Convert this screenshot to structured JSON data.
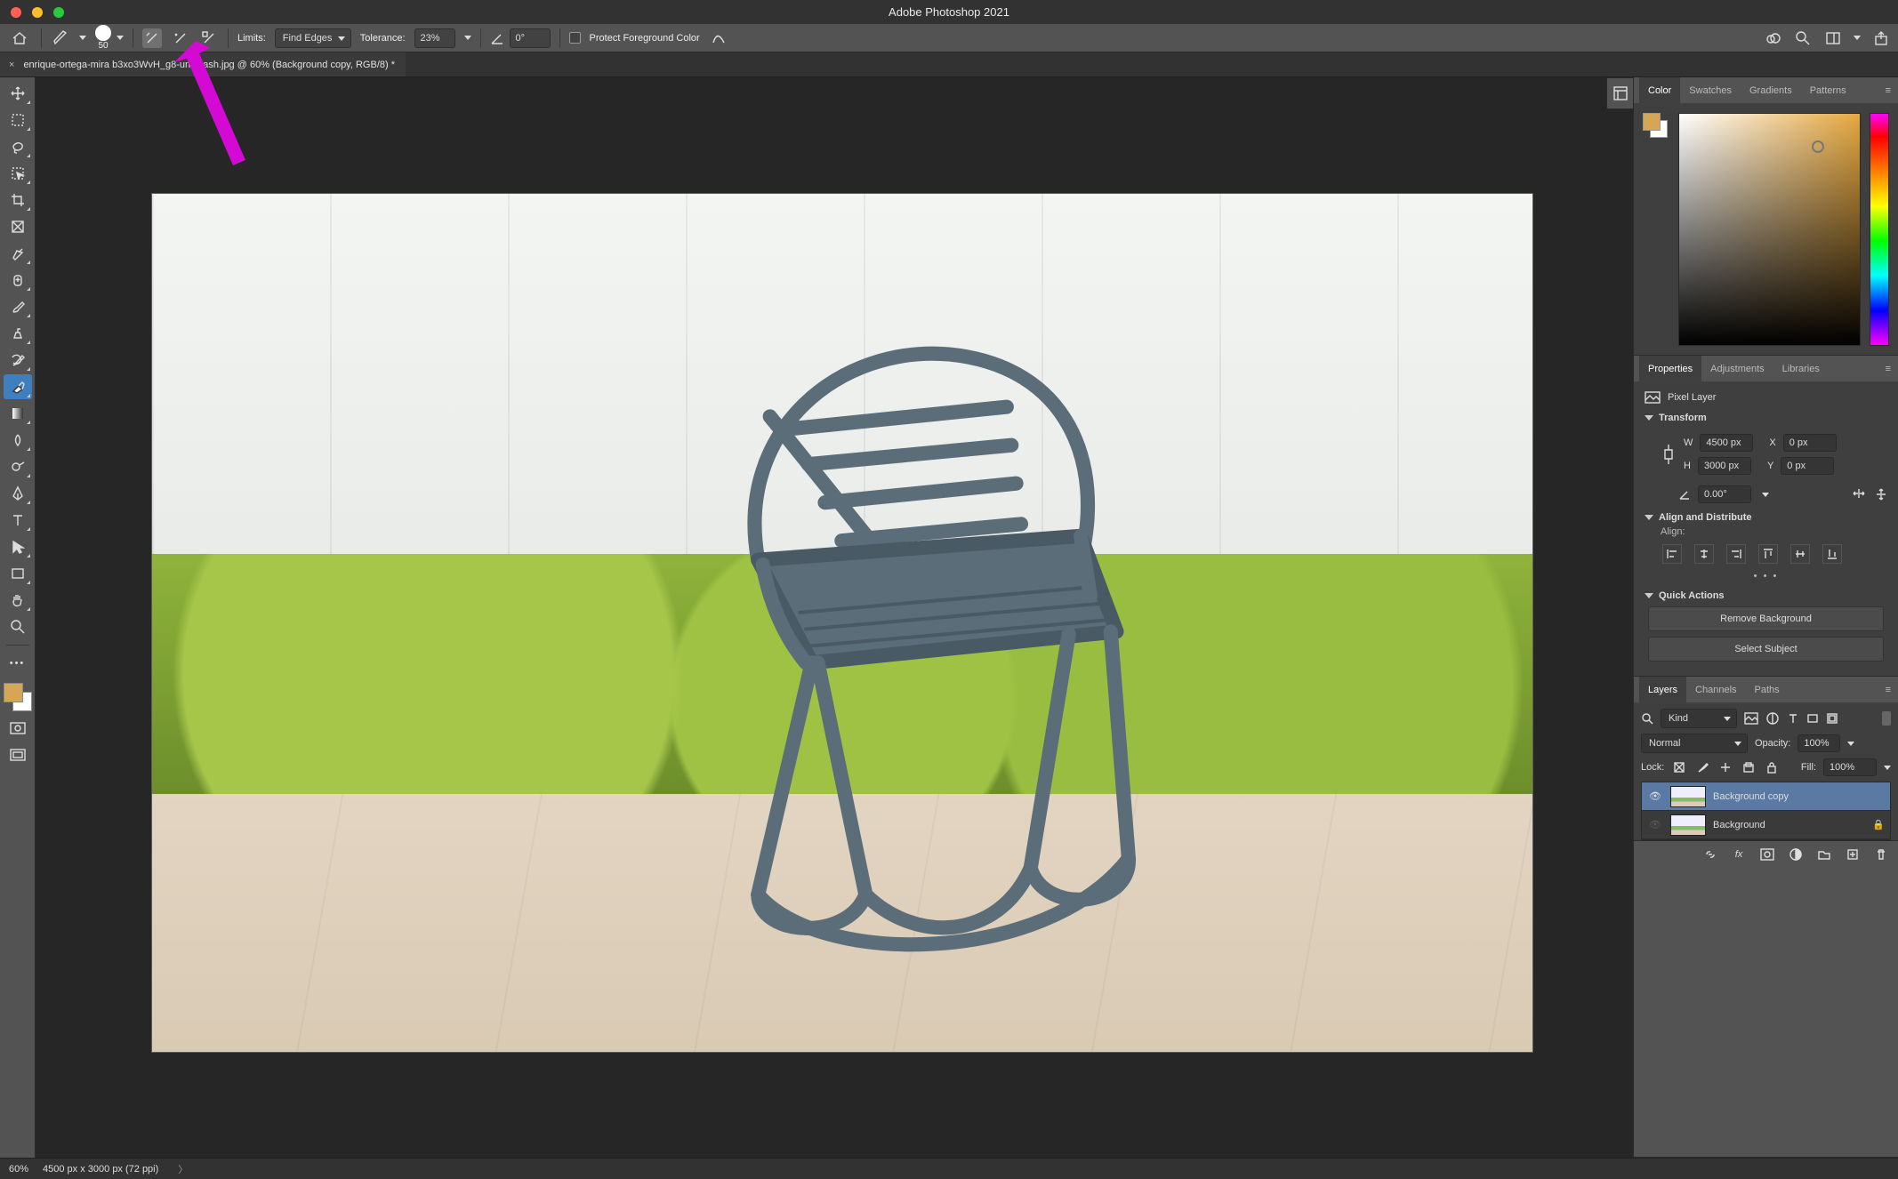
{
  "window": {
    "title": "Adobe Photoshop 2021"
  },
  "options": {
    "brush_size": "50",
    "limits_label": "Limits:",
    "limits_value": "Find Edges",
    "tolerance_label": "Tolerance:",
    "tolerance_value": "23%",
    "angle_value": "0°",
    "protect_label": "Protect Foreground Color"
  },
  "doc": {
    "tab_name": "enrique-ortega-mira        b3xo3WvH_g8-unsplash.jpg @ 60% (Background copy, RGB/8) *"
  },
  "panels": {
    "color": {
      "tabs": [
        "Color",
        "Swatches",
        "Gradients",
        "Patterns"
      ]
    },
    "properties": {
      "tabs": [
        "Properties",
        "Adjustments",
        "Libraries"
      ],
      "layer_type": "Pixel Layer",
      "transform_label": "Transform",
      "W_label": "W",
      "W_value": "4500 px",
      "H_label": "H",
      "H_value": "3000 px",
      "X_label": "X",
      "X_value": "0 px",
      "Y_label": "Y",
      "Y_value": "0 px",
      "angle_value": "0.00°",
      "align_label": "Align and Distribute",
      "align_sub": "Align:",
      "qa_label": "Quick Actions",
      "qa_remove": "Remove Background",
      "qa_select": "Select Subject"
    },
    "layers": {
      "tabs": [
        "Layers",
        "Channels",
        "Paths"
      ],
      "kind": "Kind",
      "blend": "Normal",
      "opacity_label": "Opacity:",
      "opacity_value": "100%",
      "lock_label": "Lock:",
      "fill_label": "Fill:",
      "fill_value": "100%",
      "items": [
        {
          "name": "Background copy",
          "visible": true,
          "selected": true,
          "locked": false
        },
        {
          "name": "Background",
          "visible": false,
          "selected": false,
          "locked": true
        }
      ]
    }
  },
  "status": {
    "zoom": "60%",
    "dims": "4500 px x 3000 px (72 ppi)"
  }
}
